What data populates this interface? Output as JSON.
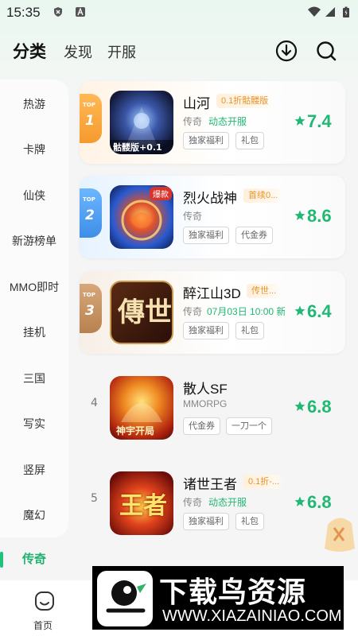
{
  "status_bar": {
    "time": "15:35"
  },
  "header": {
    "tabs": [
      {
        "label": "分类",
        "active": true
      },
      {
        "label": "发现"
      },
      {
        "label": "开服"
      }
    ],
    "download_icon": "download-circle-icon",
    "search_icon": "search-icon"
  },
  "sidebar": {
    "items": [
      "热游",
      "卡牌",
      "仙侠",
      "新游榜单",
      "MMO即时",
      "挂机",
      "三国",
      "写实",
      "竖屏",
      "魔幻",
      "传奇"
    ],
    "active_index": 10
  },
  "games": [
    {
      "rank_label": "TOP",
      "rank": "1",
      "name": "山河",
      "promo": "0.1折骷髅版",
      "genre": "传奇",
      "status": "动态开服",
      "tags": [
        "独家福利",
        "礼包"
      ],
      "score": "7.4",
      "icon_caption": "骷髅版+0.1"
    },
    {
      "rank_label": "TOP",
      "rank": "2",
      "name": "烈火战神",
      "promo": "首续0...",
      "genre": "传奇",
      "status": "",
      "tags": [
        "独家福利",
        "代金券"
      ],
      "score": "8.6",
      "icon_caption": "爆款"
    },
    {
      "rank_label": "TOP",
      "rank": "3",
      "name": "醉江山3D",
      "promo": "传世...",
      "genre": "传奇",
      "status": "07月03日 10:00 新",
      "tags": [
        "独家福利",
        "礼包"
      ],
      "score": "6.4",
      "icon_caption": "傳世"
    },
    {
      "rank": "4",
      "name": "散人SF",
      "promo": "",
      "genre": "MMORPG",
      "status": "",
      "tags": [
        "代金券",
        "一刀一个"
      ],
      "score": "6.8",
      "icon_caption": "神宇开局"
    },
    {
      "rank": "5",
      "name": "诸世王者",
      "promo": "0.1折-...",
      "genre": "传奇",
      "status": "动态开服",
      "tags": [
        "独家福利",
        "礼包"
      ],
      "score": "6.8",
      "icon_caption": "王者"
    }
  ],
  "bottom_nav": {
    "home_label": "首页"
  },
  "watermark": {
    "title": "下载鸟资源",
    "url": "WWW.XIAZAINIAO.COM"
  },
  "colors": {
    "accent": "#20b872",
    "promo": "#e9932a",
    "top1": "#f5a03c",
    "top2": "#4a9ff0",
    "top3": "#c08a5a"
  }
}
